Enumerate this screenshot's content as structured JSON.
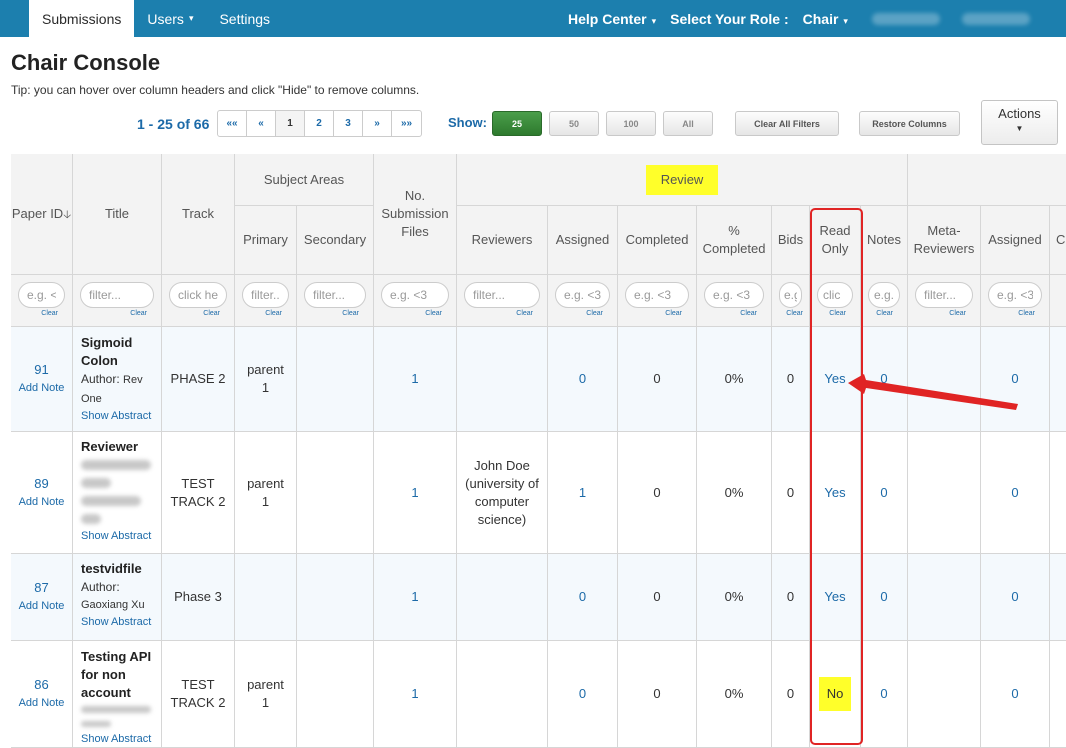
{
  "nav": {
    "items": [
      {
        "label": "Submissions",
        "active": true,
        "caret": false
      },
      {
        "label": "Users",
        "active": false,
        "caret": true
      },
      {
        "label": "Settings",
        "active": false,
        "caret": false
      }
    ],
    "help_center": "Help Center",
    "select_role_label": "Select Your Role :",
    "role": "Chair",
    "caret_glyph": "▾"
  },
  "page": {
    "title": "Chair Console",
    "tip": "Tip: you can hover over column headers and click \"Hide\" to remove columns."
  },
  "toolbar": {
    "count": "1 - 25 of 66",
    "pager": [
      "««",
      "«",
      "1",
      "2",
      "3",
      "»",
      "»»"
    ],
    "current_page": "1",
    "show_label": "Show:",
    "show_options": [
      "25",
      "50",
      "100",
      "All"
    ],
    "show_selected": "25",
    "clear_filters": "Clear All Filters",
    "restore_columns": "Restore Columns",
    "actions": "Actions",
    "actions_caret": "▼"
  },
  "table": {
    "group_headers": {
      "subject_areas": "Subject Areas",
      "review": "Review"
    },
    "headers": {
      "paper_id": "Paper ID",
      "sort_icon": "🡣",
      "title": "Title",
      "track": "Track",
      "primary": "Primary",
      "secondary": "Secondary",
      "files": "No. Submission Files",
      "reviewers": "Reviewers",
      "assigned": "Assigned",
      "completed": "Completed",
      "pct_completed": "% Completed",
      "bids": "Bids",
      "read_only": "Read Only",
      "notes": "Notes",
      "meta_reviewers": "Meta-Reviewers",
      "meta_assigned": "Assigned",
      "last_partial": "C"
    },
    "filters": {
      "paper_id": "e.g. <",
      "title": "filter...",
      "track": "click her",
      "primary": "filter...",
      "secondary": "filter...",
      "files": "e.g. <3",
      "reviewers": "filter...",
      "assigned": "e.g. <3",
      "completed": "e.g. <3",
      "pct_completed": "e.g. <3",
      "bids": "e.g",
      "read_only": "clic",
      "notes": "e.g.",
      "meta_reviewers": "filter...",
      "meta_assigned": "e.g. <3",
      "clear": "Clear"
    },
    "add_note": "Add Note",
    "show_abstract": "Show Abstract",
    "rows": [
      {
        "id": "91",
        "title": "Sigmoid Colon",
        "author_label": "Author:",
        "author": "Rev One",
        "track": "PHASE 2",
        "primary": "parent 1",
        "secondary": "",
        "files": "1",
        "reviewers": "",
        "assigned": "0",
        "completed": "0",
        "pct": "0%",
        "bids": "0",
        "read_only": "Yes",
        "notes": "0",
        "meta_reviewers": "",
        "meta_assigned": "0"
      },
      {
        "id": "89",
        "title": "Reviewer",
        "author_label": "",
        "author": "",
        "track": "TEST TRACK 2",
        "primary": "parent 1",
        "secondary": "",
        "files": "1",
        "reviewers": "John Doe (university of computer science)",
        "assigned": "1",
        "completed": "0",
        "pct": "0%",
        "bids": "0",
        "read_only": "Yes",
        "notes": "0",
        "meta_reviewers": "",
        "meta_assigned": "0"
      },
      {
        "id": "87",
        "title": "testvidfile",
        "author_label": "Author:",
        "author": "Gaoxiang Xu",
        "track": "Phase 3",
        "primary": "",
        "secondary": "",
        "files": "1",
        "reviewers": "",
        "assigned": "0",
        "completed": "0",
        "pct": "0%",
        "bids": "0",
        "read_only": "Yes",
        "notes": "0",
        "meta_reviewers": "",
        "meta_assigned": "0"
      },
      {
        "id": "86",
        "title": "Testing API for non account",
        "author_label": "",
        "author": "",
        "track": "TEST TRACK 2",
        "primary": "parent 1",
        "secondary": "",
        "files": "1",
        "reviewers": "",
        "assigned": "0",
        "completed": "0",
        "pct": "0%",
        "bids": "0",
        "read_only": "No",
        "notes": "0",
        "meta_reviewers": "",
        "meta_assigned": "0"
      }
    ]
  },
  "colors": {
    "nav": "#1c7fae",
    "link": "#1c6aa8",
    "highlight": "#ffff2a",
    "annotation": "#e02424"
  }
}
